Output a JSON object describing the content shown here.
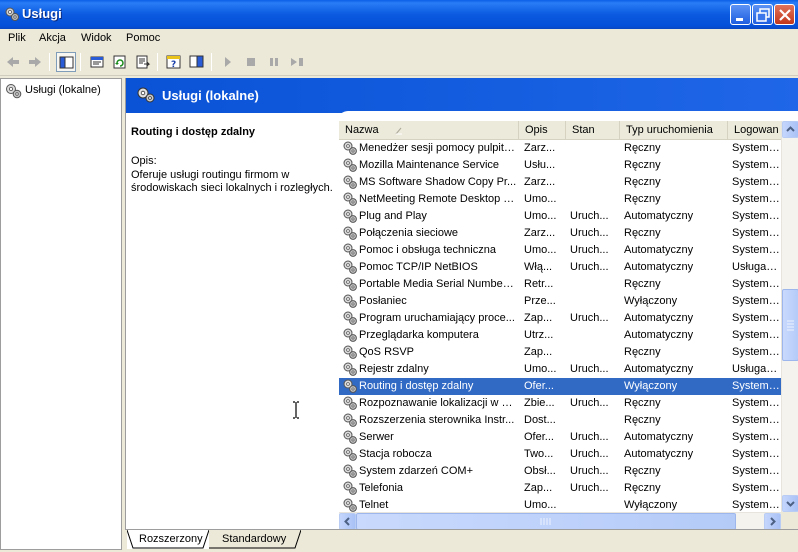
{
  "window": {
    "title": "Usługi"
  },
  "menu": [
    "Plik",
    "Akcja",
    "Widok",
    "Pomoc"
  ],
  "toolbar": {
    "buttons": [
      "back-icon",
      "forward-icon",
      "show-hide-console-tree-icon",
      "properties-icon",
      "refresh-icon",
      "export-list-icon",
      "help-icon",
      "show-hide-action-pane-icon",
      "start-service-icon",
      "stop-service-icon",
      "pause-service-icon",
      "restart-service-icon"
    ]
  },
  "tree": {
    "root_label": "Usługi (lokalne)"
  },
  "pane": {
    "header_title": "Usługi (lokalne)",
    "selected_name": "Routing i dostęp zdalny",
    "desc_label": "Opis:",
    "desc_text": "Oferuje usługi routingu firmom w środowiskach sieci lokalnych i rozległych."
  },
  "list": {
    "columns": [
      "Nazwa",
      "Opis",
      "Stan",
      "Typ uruchomienia",
      "Logowan"
    ],
    "sorted_column": "Nazwa",
    "rows": [
      {
        "name": "Menedżer sesji pomocy pulpitu...",
        "desc": "Zarz...",
        "status": "",
        "startup": "Ręczny",
        "logon": "System lo"
      },
      {
        "name": "Mozilla Maintenance Service",
        "desc": "Usłu...",
        "status": "",
        "startup": "Ręczny",
        "logon": "System lo"
      },
      {
        "name": "MS Software Shadow Copy Pr...",
        "desc": "Zarz...",
        "status": "",
        "startup": "Ręczny",
        "logon": "System lo"
      },
      {
        "name": "NetMeeting Remote Desktop S...",
        "desc": "Umo...",
        "status": "",
        "startup": "Ręczny",
        "logon": "System lo"
      },
      {
        "name": "Plug and Play",
        "desc": "Umo...",
        "status": "Uruch...",
        "startup": "Automatyczny",
        "logon": "System lo"
      },
      {
        "name": "Połączenia sieciowe",
        "desc": "Zarz...",
        "status": "Uruch...",
        "startup": "Ręczny",
        "logon": "System lo"
      },
      {
        "name": "Pomoc i obsługa techniczna",
        "desc": "Umo...",
        "status": "Uruch...",
        "startup": "Automatyczny",
        "logon": "System lo"
      },
      {
        "name": "Pomoc TCP/IP NetBIOS",
        "desc": "Włą...",
        "status": "Uruch...",
        "startup": "Automatyczny",
        "logon": "Usługa lol"
      },
      {
        "name": "Portable Media Serial Number ...",
        "desc": "Retr...",
        "status": "",
        "startup": "Ręczny",
        "logon": "System lo"
      },
      {
        "name": "Posłaniec",
        "desc": "Prze...",
        "status": "",
        "startup": "Wyłączony",
        "logon": "System lo"
      },
      {
        "name": "Program uruchamiający proce...",
        "desc": "Zap...",
        "status": "Uruch...",
        "startup": "Automatyczny",
        "logon": "System lo"
      },
      {
        "name": "Przeglądarka komputera",
        "desc": "Utrz...",
        "status": "",
        "startup": "Automatyczny",
        "logon": "System lo"
      },
      {
        "name": "QoS RSVP",
        "desc": "Zap...",
        "status": "",
        "startup": "Ręczny",
        "logon": "System lo"
      },
      {
        "name": "Rejestr zdalny",
        "desc": "Umo...",
        "status": "Uruch...",
        "startup": "Automatyczny",
        "logon": "Usługa lol"
      },
      {
        "name": "Routing i dostęp zdalny",
        "desc": "Ofer...",
        "status": "",
        "startup": "Wyłączony",
        "logon": "System lo",
        "selected": true
      },
      {
        "name": "Rozpoznawanie lokalizacji w si...",
        "desc": "Zbie...",
        "status": "Uruch...",
        "startup": "Ręczny",
        "logon": "System lo"
      },
      {
        "name": "Rozszerzenia sterownika Instr...",
        "desc": "Dost...",
        "status": "",
        "startup": "Ręczny",
        "logon": "System lo"
      },
      {
        "name": "Serwer",
        "desc": "Ofer...",
        "status": "Uruch...",
        "startup": "Automatyczny",
        "logon": "System lo"
      },
      {
        "name": "Stacja robocza",
        "desc": "Two...",
        "status": "Uruch...",
        "startup": "Automatyczny",
        "logon": "System lo"
      },
      {
        "name": "System zdarzeń COM+",
        "desc": "Obsł...",
        "status": "Uruch...",
        "startup": "Ręczny",
        "logon": "System lo"
      },
      {
        "name": "Telefonia",
        "desc": "Zap...",
        "status": "Uruch...",
        "startup": "Ręczny",
        "logon": "System lo"
      },
      {
        "name": "Telnet",
        "desc": "Umo...",
        "status": "",
        "startup": "Wyłączony",
        "logon": "System lo"
      }
    ]
  },
  "tabs": [
    {
      "label": "Rozszerzony",
      "active": true
    },
    {
      "label": "Standardowy",
      "active": false
    }
  ],
  "colors": {
    "title_bar": "#0a5fe6",
    "selection": "#316ac5",
    "banner": "#0a52d6",
    "face": "#ece9d8"
  }
}
